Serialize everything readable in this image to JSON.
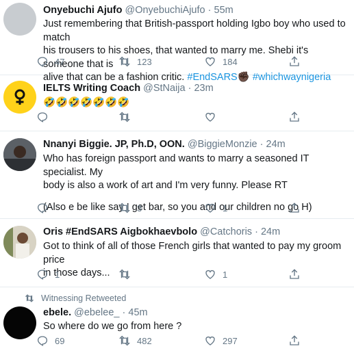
{
  "tweets": [
    {
      "name": "Onyebuchi Ajufo",
      "handle": "@OnyebuchiAjufo",
      "time": "55m",
      "text_lines": [
        "Just remembering that British-passport holding Igbo boy who used to match",
        "his trousers to his shoes, that wanted to marry me. Shebi it's someone that is",
        "alive that can be a fashion critic."
      ],
      "hashtags": [
        "#EndSARS",
        "#whichwaynigeria"
      ],
      "emoji": "✊🏿",
      "replies": "47",
      "retweets": "123",
      "likes": "184"
    },
    {
      "name": "IELTS Writing Coach",
      "handle": "@StNaija",
      "time": "23m",
      "text": "🤣🤣🤣🤣🤣🤣🤣",
      "replies": "",
      "retweets": "",
      "likes": ""
    },
    {
      "name": "Nnanyi Biggie. JP, Ph.D, OON.",
      "handle": "@BiggieMonzie",
      "time": "24m",
      "text_lines": [
        "Who has foreign passport and wants to marry a seasoned IT specialist. My",
        "body is also a work of art and I'm very funny. Please RT"
      ],
      "text_extra": "(Also e be like say I get bar, so you and our children no go H)",
      "replies": "",
      "retweets": "3",
      "likes": "1"
    },
    {
      "name": "Oris #EndSARS Aigbokhaevbolo",
      "handle": "@Catchoris",
      "time": "24m",
      "text_lines": [
        "Got to think of all of those French girls that wanted to pay my groom price",
        "in those days..."
      ],
      "replies": "1",
      "retweets": "",
      "likes": "1"
    },
    {
      "retweeted_by": "Witnessing Retweeted",
      "name": "ebele.",
      "handle": "@ebelee_",
      "time": "45m",
      "text": "So where do we go from here ?",
      "replies": "69",
      "retweets": "482",
      "likes": "297"
    }
  ],
  "separator": "·",
  "colors": {
    "text": "#14171a",
    "meta": "#657786",
    "link": "#1b95e0",
    "divider": "#e6ecf0"
  }
}
